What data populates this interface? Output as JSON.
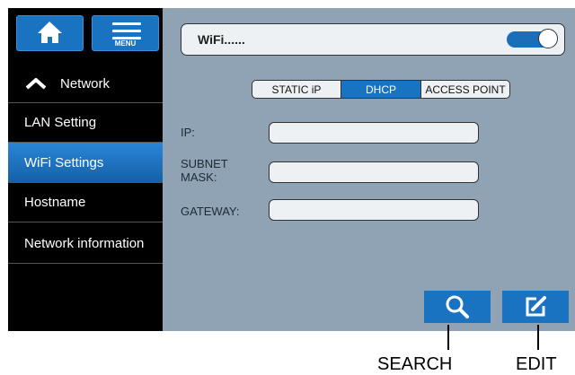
{
  "sidebar": {
    "home_button_icon": "home-icon",
    "menu_button_label": "MENU",
    "section_title": "Network",
    "items": [
      {
        "label": "LAN Setting",
        "active": false
      },
      {
        "label": "WiFi Settings",
        "active": true
      },
      {
        "label": "Hostname",
        "active": false
      },
      {
        "label": "Network information",
        "active": false
      }
    ]
  },
  "wifi": {
    "label": "WiFi......",
    "toggle_on": true
  },
  "modes": {
    "static": "STATIC iP",
    "dhcp": "DHCP",
    "access_point": "ACCESS POINT",
    "selected": "DHCP"
  },
  "fields": {
    "ip_label": "IP:",
    "subnet_label_line1": "SUBNET",
    "subnet_label_line2": "MASK:",
    "gateway_label": "GATEWAY:",
    "ip_value": "",
    "subnet_value": "",
    "gateway_value": ""
  },
  "actions": {
    "search_icon": "search-icon",
    "edit_icon": "edit-icon"
  },
  "callouts": {
    "search": "SEARCH",
    "edit": "EDIT"
  },
  "colors": {
    "accent": "#1a73c0",
    "content_bg": "#8fa3b5",
    "sidebar_bg": "#000000"
  }
}
